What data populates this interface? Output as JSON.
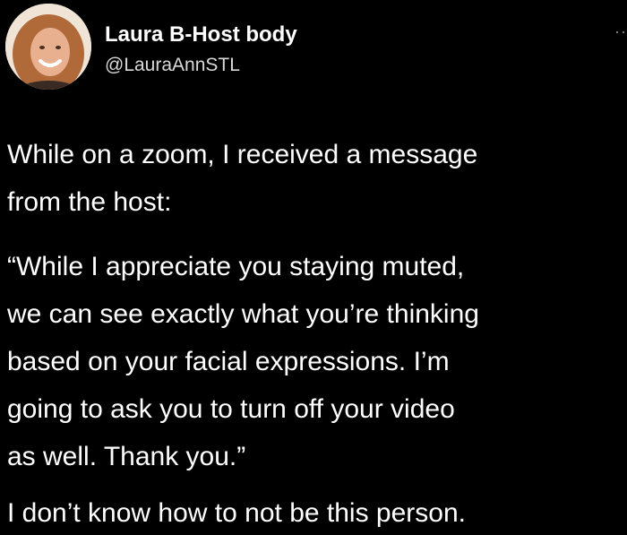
{
  "tweet": {
    "author": {
      "display_name": "Laura B-Host body",
      "handle": "@LauraAnnSTL",
      "avatar_icon": "profile-photo-avatar"
    },
    "more_label": "··",
    "body": {
      "paragraph_1": [
        "While on a zoom, I received a message",
        "from the host:"
      ],
      "paragraph_2": [
        "“While I appreciate you staying muted,",
        "we can see exactly what you’re thinking",
        "based on your facial expressions. I’m",
        "going to ask you to turn off your video",
        "as well. Thank you.”"
      ],
      "paragraph_3": [
        "I don’t know how to not be this person."
      ]
    }
  },
  "colors": {
    "background": "#000000",
    "text": "#ffffff",
    "secondary_text": "#d9d9d9"
  }
}
